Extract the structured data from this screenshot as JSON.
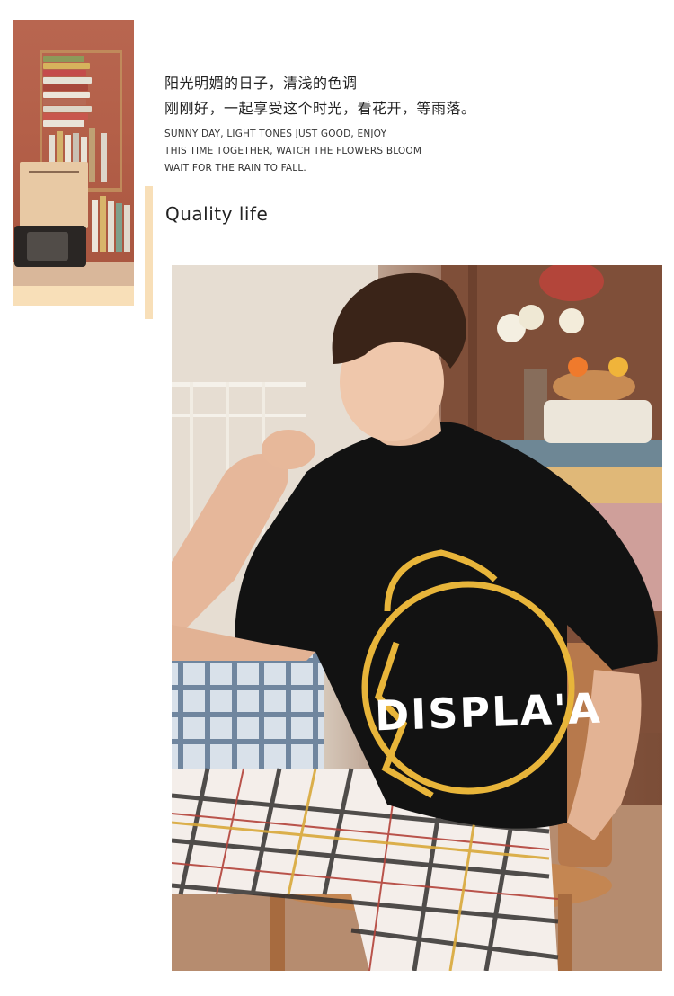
{
  "text": {
    "cn_line1": "阳光明媚的日子，清浅的色调",
    "cn_line2": "刚刚好，一起享受这个时光，看花开，等雨落。",
    "en_line1": "SUNNY DAY, LIGHT TONES JUST GOOD, ENJOY",
    "en_line2": "THIS TIME TOGETHER, WATCH THE FLOWERS BLOOM",
    "en_line3": "WAIT FOR THE RAIN TO FALL.",
    "heading": "Quality life"
  },
  "photo": {
    "shirt_print": "DISPLA'A"
  },
  "colors": {
    "accent": "#f8dfb8",
    "text": "#222222",
    "shirt": "#111111",
    "print_gold": "#e8b53a"
  }
}
